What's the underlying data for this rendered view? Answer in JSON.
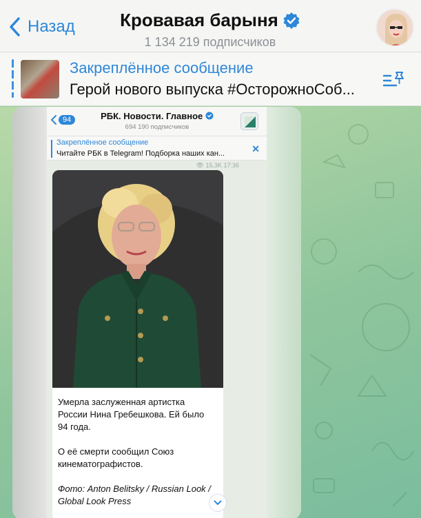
{
  "header": {
    "back_label": "Назад",
    "title": "Кровавая барыня",
    "subscribers": "1 134 219 подписчиков"
  },
  "pinned": {
    "title": "Закреплённое сообщение",
    "text": "Герой нового выпуска #ОсторожноСоб..."
  },
  "embedded": {
    "badge": "94",
    "title": "РБК. Новости. Главное",
    "subscribers": "694 190 подписчиков",
    "pinned_title": "Закреплённое сообщение",
    "pinned_text": "Читайте РБК в Telegram! Подборка наших кан...",
    "meta": "15,3K 17:36",
    "message_lines": [
      "Умерла заслуженная артистка России Нина Гребешкова. Ей было 94 года.",
      "О её смерти сообщил Союз кинематографистов.",
      "Фото: Anton Belitsky / Russian Look / Global Look Press"
    ]
  },
  "colors": {
    "accent": "#2e87d8",
    "chat_bg": "#9ccf9f"
  }
}
